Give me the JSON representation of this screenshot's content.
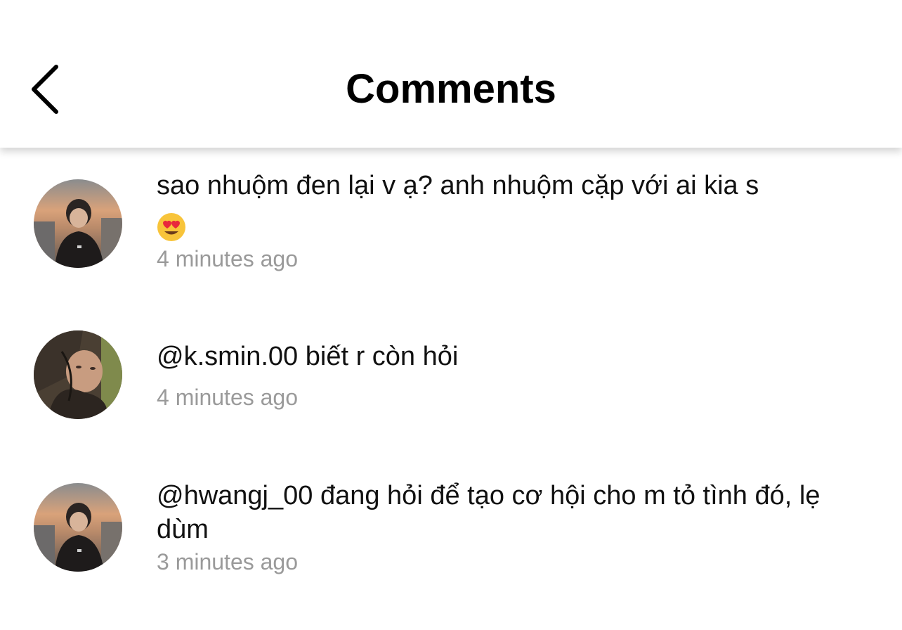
{
  "header": {
    "title": "Comments",
    "back_icon": "chevron-left-icon"
  },
  "comments": [
    {
      "text": "sao nhuộm đen lại v ạ? anh nhuộm cặp với ai kia s",
      "emoji": "heart-eyes-emoji-icon",
      "time": "4 minutes ago"
    },
    {
      "text": "@k.smin.00 biết r còn hỏi",
      "time": "4 minutes ago"
    },
    {
      "text": "@hwangj_00 đang hỏi để tạo cơ hội cho m tỏ tình đó, lẹ dùm",
      "time": "3 minutes ago"
    }
  ],
  "colors": {
    "text": "#111111",
    "timestamp": "#9a9a9a",
    "background": "#ffffff"
  }
}
